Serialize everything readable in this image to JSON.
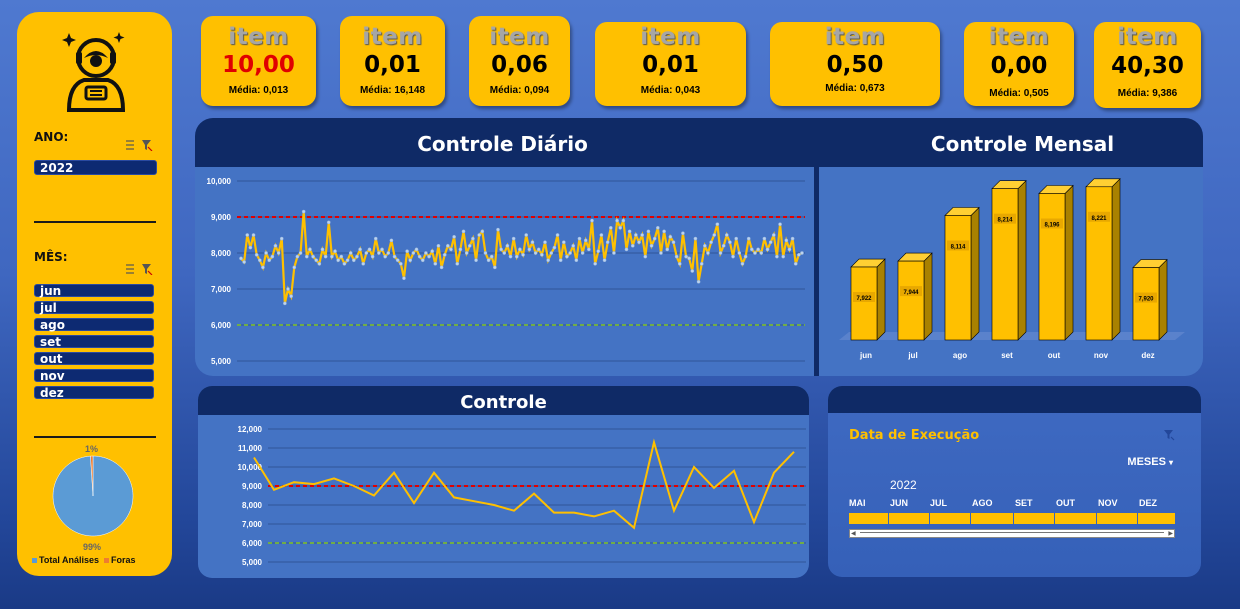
{
  "sidebar": {
    "ano_label": "ANO:",
    "ano_value": "2022",
    "mes_label": "MÊS:",
    "months": [
      "jun",
      "jul",
      "ago",
      "set",
      "out",
      "nov",
      "dez"
    ],
    "pie": {
      "top_label": "1%",
      "bottom_label": "99%",
      "values": [
        99,
        1
      ],
      "colors": [
        "#5b9bd5",
        "#ed7d31"
      ],
      "legend": [
        "Total Análises",
        "Foras"
      ]
    }
  },
  "kpis": [
    {
      "title": "item",
      "value": "10,00",
      "media_label": "Média:",
      "media": "0,013",
      "highlight": true
    },
    {
      "title": "item",
      "value": "0,01",
      "media_label": "Média:",
      "media": "16,148",
      "highlight": false
    },
    {
      "title": "item",
      "value": "0,06",
      "media_label": "Média:",
      "media": "0,094",
      "highlight": false
    },
    {
      "title": "item",
      "value": "0,01",
      "media_label": "Média:",
      "media": "0,043",
      "highlight": false
    },
    {
      "title": "item",
      "value": "0,50",
      "media_label": "Média:",
      "media": "0,673",
      "highlight": false
    },
    {
      "title": "item",
      "value": "0,00",
      "media_label": "Média:",
      "media": "0,505",
      "highlight": false
    },
    {
      "title": "item",
      "value": "40,30",
      "media_label": "Média:",
      "media": "9,386",
      "highlight": false
    }
  ],
  "colors": {
    "accent": "#ffc000",
    "header": "#0f2a66",
    "panel": "#4473c4",
    "limit_high": "#e00000",
    "limit_low": "#70ad47"
  },
  "daily": {
    "title": "Controle Diário"
  },
  "monthly": {
    "title": "Controle Mensal"
  },
  "controle": {
    "title": "Controle"
  },
  "timeline": {
    "title": "Data de Execução",
    "level": "MESES",
    "year": "2022",
    "months": [
      "MAI",
      "JUN",
      "JUL",
      "AGO",
      "SET",
      "OUT",
      "NOV",
      "DEZ"
    ]
  },
  "chart_data": [
    {
      "type": "line",
      "title": "Controle Diário",
      "ylim": [
        5000,
        10000
      ],
      "yticks": [
        "5,000",
        "6,000",
        "7,000",
        "8,000",
        "9,000",
        "10,000"
      ],
      "limit_high": 9000,
      "limit_low": 6000,
      "values": [
        7850,
        7750,
        8500,
        8150,
        8500,
        7950,
        7800,
        7600,
        8000,
        7800,
        7900,
        8200,
        8000,
        8400,
        6600,
        7000,
        6800,
        7600,
        7900,
        8000,
        9150,
        7900,
        8100,
        7900,
        7800,
        7700,
        8100,
        7900,
        8850,
        7900,
        8050,
        7800,
        7900,
        7700,
        7800,
        8000,
        7800,
        7900,
        8100,
        7700,
        8000,
        8100,
        7900,
        8400,
        8000,
        8100,
        7900,
        8000,
        8350,
        7900,
        7800,
        7700,
        7300,
        8050,
        7800,
        8000,
        8100,
        7900,
        7800,
        8000,
        7900,
        8050,
        7700,
        8200,
        7600,
        7950,
        8200,
        8100,
        8450,
        7700,
        8100,
        8600,
        8000,
        8200,
        8400,
        7800,
        8500,
        8600,
        8000,
        7800,
        7900,
        7600,
        8650,
        8100,
        8000,
        8200,
        7900,
        8400,
        7900,
        8100,
        7950,
        8500,
        8100,
        8300,
        8000,
        8100,
        7950,
        8300,
        7800,
        8000,
        8150,
        8500,
        7800,
        8300,
        7900,
        8000,
        8200,
        7800,
        8400,
        8000,
        8350,
        8100,
        8900,
        7700,
        8050,
        8500,
        7800,
        8300,
        8700,
        8000,
        8900,
        8700,
        8900,
        8100,
        8600,
        8200,
        8500,
        8300,
        8500,
        7900,
        8600,
        8200,
        8400,
        8700,
        8000,
        8600,
        8100,
        8450,
        8300,
        7900,
        7700,
        8550,
        7900,
        7850,
        7500,
        8400,
        7200,
        7700,
        8200,
        8000,
        8300,
        8500,
        8800,
        8000,
        8200,
        8500,
        8300,
        7900,
        8400,
        8000,
        7700,
        7900,
        8400,
        8100,
        8000,
        8100,
        8000,
        8400,
        8100,
        8300,
        8500,
        7900,
        8800,
        7900,
        8350,
        8100,
        8400,
        7700,
        7950,
        8000
      ]
    },
    {
      "type": "bar",
      "title": "Controle Mensal",
      "categories": [
        "jun",
        "jul",
        "ago",
        "set",
        "out",
        "nov",
        "dez"
      ],
      "values": [
        7922,
        7944,
        8114,
        8214,
        8196,
        8221,
        7920
      ],
      "labels": [
        "7,922",
        "7,944",
        "8,114",
        "8,214",
        "8,196",
        "8,221",
        "7,920"
      ],
      "ylim": [
        7650,
        8250
      ]
    },
    {
      "type": "line",
      "title": "Controle",
      "ylim": [
        5000,
        12000
      ],
      "yticks": [
        "5,000",
        "6,000",
        "7,000",
        "8,000",
        "9,000",
        "10,000",
        "11,000",
        "12,000"
      ],
      "limit_high": 9000,
      "limit_low": 6000,
      "values": [
        10500,
        8800,
        9200,
        9100,
        9400,
        9000,
        8500,
        9700,
        8100,
        9700,
        8400,
        8200,
        8000,
        7700,
        8600,
        7600,
        7600,
        7400,
        7700,
        6800,
        11300,
        7700,
        10000,
        8900,
        9800,
        7100,
        9700,
        10800
      ]
    }
  ]
}
